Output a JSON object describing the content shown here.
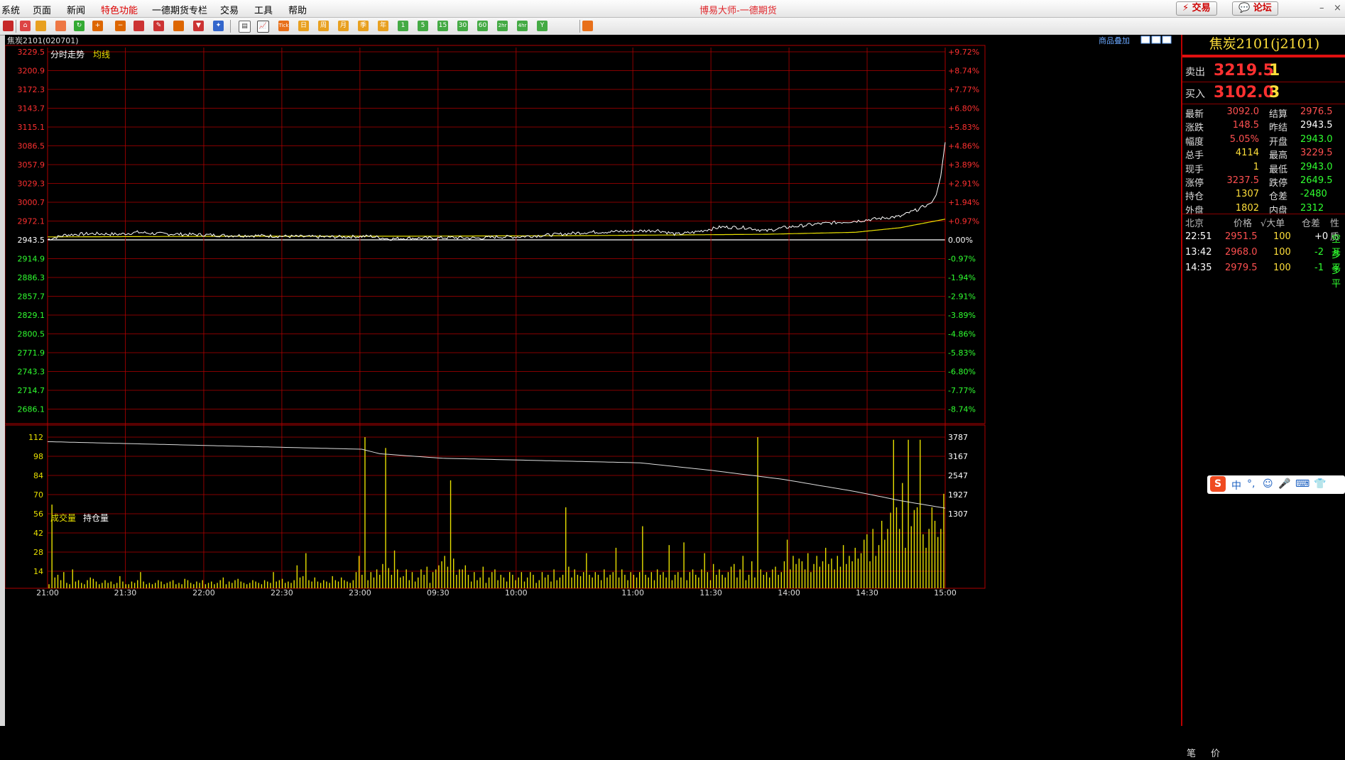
{
  "menu": {
    "items": [
      "系统",
      "页面",
      "新闻",
      "特色功能",
      "一德期货专栏",
      "交易",
      "工具",
      "帮助"
    ],
    "window_title": "博易大师-一德期货",
    "trade_button": "交易",
    "forum_button": "论坛"
  },
  "toolbar": {
    "icons": [
      "home-icon",
      "folder-icon",
      "news-icon",
      "refresh-icon",
      "zoom-in-icon",
      "zoom-out-icon",
      "window-icon",
      "pen-icon",
      "draw-icon",
      "filter-icon",
      "star-icon",
      "table-icon",
      "chart-icon",
      "tick-icon",
      "day-icon",
      "week-icon",
      "month-icon",
      "season-icon",
      "year-icon",
      "min1-icon",
      "min5-icon",
      "min15-icon",
      "min30-icon",
      "min60-icon",
      "min120-icon",
      "min240-icon",
      "custom-icon",
      "calc-icon"
    ],
    "labels": {
      "tick": "Tick",
      "day": "日",
      "week": "周",
      "month": "月",
      "season": "季",
      "year": "年",
      "m1": "1",
      "m5": "5",
      "m15": "15",
      "m30": "30",
      "m60": "60",
      "m2h": "2hr",
      "m4h": "4hr",
      "cust": "Y"
    }
  },
  "chart": {
    "header_left": "焦炭2101(020701)",
    "header_right": "商品叠加",
    "price_legend": [
      "分时走势",
      "均线"
    ],
    "volume_legend": [
      "成交量",
      "持仓量"
    ],
    "colors": {
      "up": "#ff3030",
      "down": "#30ff30",
      "base": "#ffffff",
      "grid": "#b00000",
      "price_line": "#ffffff",
      "avg_line": "#e8e000",
      "volume_bar": "#e8e000"
    },
    "time_labels": [
      "21:00",
      "21:30",
      "22:00",
      "22:30",
      "23:00",
      "09:30",
      "10:00",
      "11:00",
      "11:30",
      "14:00",
      "14:30",
      "15:00"
    ]
  },
  "chart_data": [
    {
      "type": "line",
      "title": "分时走势",
      "y_labels": [
        "3229.5",
        "3200.9",
        "3172.3",
        "3143.7",
        "3115.1",
        "3086.5",
        "3057.9",
        "3029.3",
        "3000.7",
        "2972.1",
        "2943.5",
        "2914.9",
        "2886.3",
        "2857.7",
        "2829.1",
        "2800.5",
        "2771.9",
        "2743.3",
        "2714.7",
        "2686.1"
      ],
      "pct_labels": [
        "+9.72%",
        "+8.74%",
        "+7.77%",
        "+6.80%",
        "+5.83%",
        "+4.86%",
        "+3.89%",
        "+2.91%",
        "+1.94%",
        "+0.97%",
        "0.00%",
        "-0.97%",
        "-1.94%",
        "-2.91%",
        "-3.89%",
        "-4.86%",
        "-5.83%",
        "-6.80%",
        "-7.77%",
        "-8.74%"
      ],
      "ylim": [
        2686.1,
        3229.5
      ],
      "base_price": 2943.5,
      "series": [
        {
          "name": "分时走势",
          "x": [
            0,
            0.02,
            0.05,
            0.08,
            0.1,
            0.12,
            0.15,
            0.18,
            0.2,
            0.23,
            0.26,
            0.3,
            0.33,
            0.36,
            0.38,
            0.4,
            0.42,
            0.45,
            0.48,
            0.5,
            0.52,
            0.55,
            0.58,
            0.6,
            0.63,
            0.66,
            0.68,
            0.7,
            0.72,
            0.75,
            0.78,
            0.8,
            0.82,
            0.84,
            0.86,
            0.88,
            0.9,
            0.92,
            0.94,
            0.95,
            0.96,
            0.97,
            0.98,
            0.985,
            0.99,
            0.995,
            1.0
          ],
          "values": [
            2944,
            2951,
            2953,
            2952,
            2955,
            2953,
            2952,
            2951,
            2950,
            2950,
            2949,
            2948,
            2948,
            2949,
            2945,
            2946,
            2946,
            2947,
            2946,
            2948,
            2948,
            2950,
            2953,
            2955,
            2956,
            2957,
            2958,
            2952,
            2955,
            2963,
            2962,
            2957,
            2962,
            2965,
            2968,
            2970,
            2972,
            2975,
            2978,
            2979,
            2985,
            2990,
            2997,
            3000,
            3012,
            3040,
            3092
          ]
        },
        {
          "name": "均线",
          "x": [
            0,
            0.2,
            0.4,
            0.6,
            0.8,
            0.9,
            0.95,
            1.0
          ],
          "values": [
            2948,
            2949,
            2949,
            2950,
            2952,
            2955,
            2962,
            2975
          ]
        }
      ]
    },
    {
      "type": "bar",
      "title": "成交量",
      "y_labels_left": [
        "112",
        "98",
        "84",
        "70",
        "56",
        "42",
        "28",
        "14"
      ],
      "y_labels_right": [
        "3787",
        "3167",
        "2547",
        "1927",
        "1307"
      ],
      "ylim": [
        0,
        120
      ],
      "volumes": [
        3,
        62,
        8,
        10,
        6,
        12,
        4,
        3,
        14,
        5,
        6,
        4,
        3,
        6,
        8,
        7,
        5,
        3,
        4,
        6,
        4,
        5,
        3,
        4,
        9,
        5,
        3,
        3,
        5,
        4,
        6,
        12,
        5,
        3,
        4,
        3,
        4,
        6,
        5,
        3,
        4,
        5,
        6,
        3,
        4,
        3,
        7,
        6,
        4,
        3,
        5,
        4,
        6,
        3,
        4,
        5,
        3,
        4,
        6,
        8,
        3,
        5,
        4,
        6,
        7,
        5,
        4,
        3,
        4,
        6,
        5,
        4,
        3,
        6,
        5,
        4,
        12,
        5,
        6,
        7,
        4,
        5,
        4,
        6,
        17,
        8,
        9,
        26,
        6,
        5,
        8,
        5,
        4,
        6,
        5,
        4,
        9,
        6,
        5,
        8,
        6,
        5,
        4,
        6,
        12,
        24,
        10,
        112,
        6,
        12,
        8,
        14,
        10,
        18,
        104,
        15,
        10,
        28,
        14,
        8,
        9,
        14,
        6,
        12,
        5,
        8,
        14,
        10,
        16,
        4,
        12,
        14,
        17,
        20,
        24,
        16,
        80,
        22,
        10,
        14,
        14,
        17,
        10,
        5,
        12,
        6,
        8,
        16,
        4,
        8,
        12,
        14,
        6,
        10,
        8,
        5,
        12,
        10,
        6,
        8,
        12,
        5,
        8,
        12,
        10,
        4,
        6,
        12,
        8,
        10,
        5,
        14,
        6,
        8,
        10,
        60,
        16,
        8,
        14,
        10,
        9,
        12,
        26,
        10,
        8,
        12,
        10,
        6,
        14,
        8,
        10,
        12,
        30,
        8,
        14,
        10,
        6,
        12,
        10,
        8,
        12,
        46,
        10,
        8,
        12,
        6,
        14,
        10,
        12,
        8,
        32,
        6,
        10,
        12,
        8,
        34,
        6,
        12,
        14,
        10,
        8,
        14,
        26,
        12,
        6,
        18,
        10,
        14,
        10,
        8,
        12,
        16,
        18,
        8,
        14,
        24,
        6,
        10,
        20,
        8,
        112,
        14,
        10,
        12,
        8,
        14,
        16,
        10,
        12,
        20,
        36,
        14,
        24,
        18,
        22,
        20,
        14,
        26,
        12,
        18,
        24,
        16,
        20,
        30,
        18,
        22,
        14,
        24,
        16,
        32,
        18,
        24,
        20,
        30,
        22,
        26,
        36,
        40,
        20,
        44,
        24,
        32,
        50,
        36,
        44,
        56,
        110,
        60,
        44,
        78,
        30,
        110,
        46,
        58,
        60,
        110,
        40,
        30,
        44,
        60,
        50,
        38,
        44,
        70
      ],
      "open_interest_right": [
        "3787",
        "3167",
        "2547",
        "1927",
        "1307"
      ]
    }
  ],
  "quote": {
    "title": "焦炭2101(j2101)",
    "ask_label": "卖出",
    "ask_price": "3219.5",
    "ask_vol": "1",
    "bid_label": "买入",
    "bid_price": "3102.0",
    "bid_vol": "3",
    "rows": [
      {
        "l1": "最新",
        "v1": "3092.0",
        "l2": "结算",
        "v2": "2976.5"
      },
      {
        "l1": "涨跌",
        "v1": "148.5",
        "l2": "昨结",
        "v2": "2943.5"
      },
      {
        "l1": "幅度",
        "v1": "5.05%",
        "l2": "开盘",
        "v2": "2943.0"
      },
      {
        "l1": "总手",
        "v1": "4114",
        "l2": "最高",
        "v2": "3229.5"
      },
      {
        "l1": "现手",
        "v1": "1",
        "l2": "最低",
        "v2": "2943.0"
      },
      {
        "l1": "涨停",
        "v1": "3237.5",
        "l2": "跌停",
        "v2": "2649.5"
      },
      {
        "l1": "持仓",
        "v1": "1307",
        "l2": "仓差",
        "v2": "-2480"
      },
      {
        "l1": "外盘",
        "v1": "1802",
        "l2": "内盘",
        "v2": "2312"
      }
    ],
    "ticks_header": [
      "北京",
      "价格",
      "√大单",
      "仓差",
      "性质"
    ],
    "ticks": [
      {
        "time": "22:51",
        "price": "2951.5",
        "vol": "100",
        "diff": "+0",
        "type": "空开"
      },
      {
        "time": "13:42",
        "price": "2968.0",
        "vol": "100",
        "diff": "-2",
        "type": "多平"
      },
      {
        "time": "14:35",
        "price": "2979.5",
        "vol": "100",
        "diff": "-1",
        "type": "多平"
      }
    ],
    "bottom_tabs": [
      "笔",
      "价"
    ]
  },
  "ime": {
    "logo": "S",
    "items": [
      "中",
      "°,",
      "☺",
      "🎤",
      "⌨",
      "👕"
    ]
  }
}
